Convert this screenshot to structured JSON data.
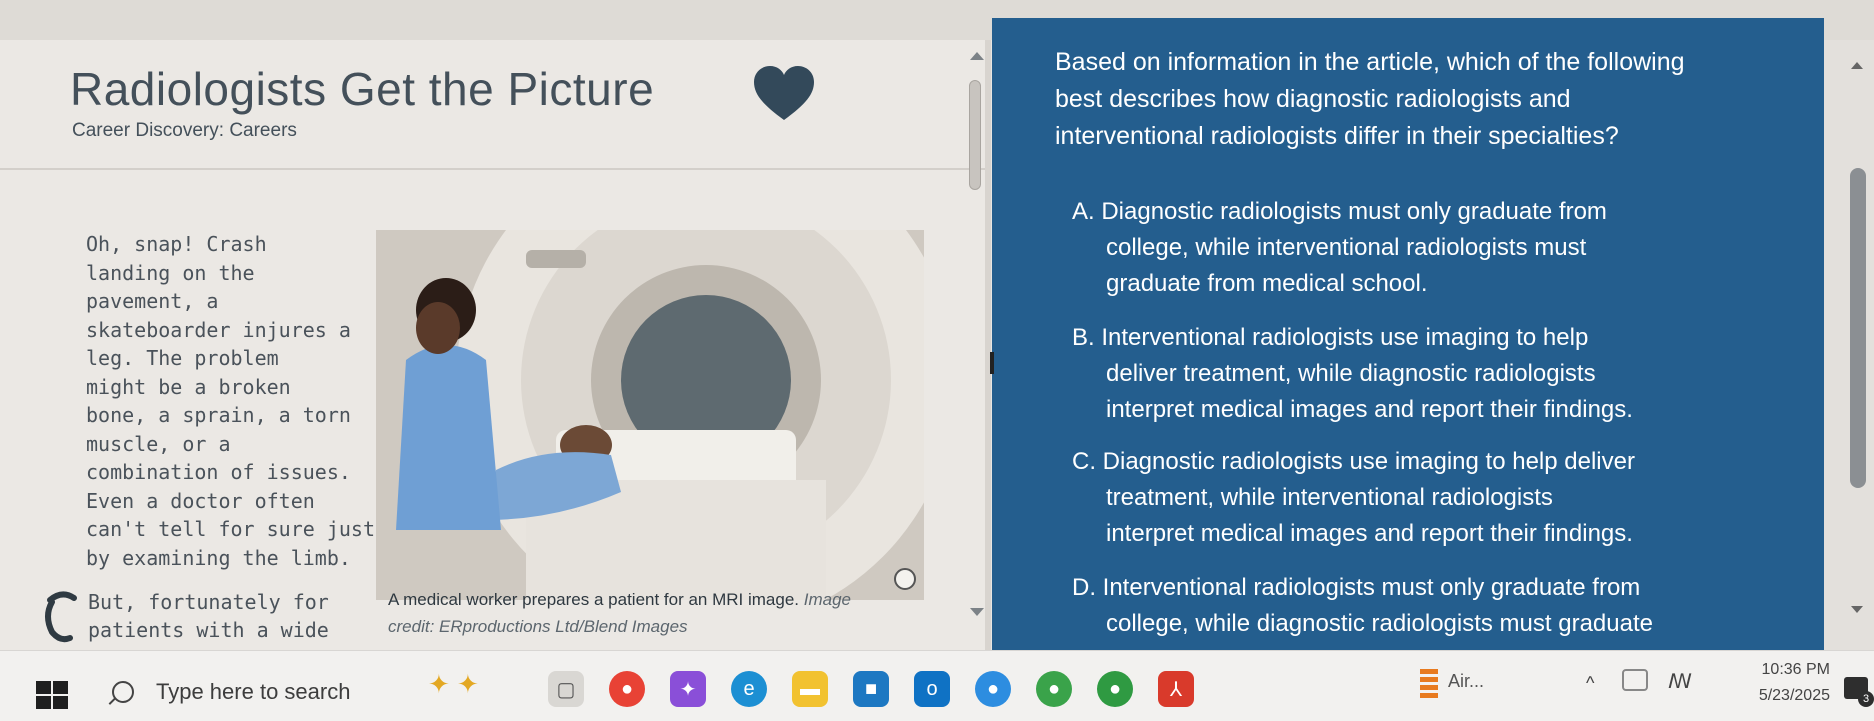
{
  "article": {
    "title": "Radiologists Get the Picture",
    "subtitle": "Career Discovery: Careers",
    "body_lines": [
      "Oh, snap! Crash",
      "landing on the",
      "pavement, a",
      "skateboarder injures a",
      "leg. The problem",
      "might be a broken",
      "bone, a sprain, a torn",
      "muscle, or a",
      "combination of issues.",
      "Even a doctor often",
      "can't tell for sure just",
      "by examining the limb."
    ],
    "more_lines": [
      "But, fortunately for",
      "patients with a wide"
    ],
    "caption_main": "A medical worker prepares a patient for an MRI image.",
    "caption_credit_1": "Image",
    "caption_credit_2": "credit: ERproductions Ltd/Blend Images"
  },
  "question": {
    "prompt_lines": [
      "Based on information in the article, which of the following",
      "best describes how diagnostic radiologists and",
      "interventional radiologists differ in their specialties?"
    ],
    "options": [
      {
        "lines": [
          "A. Diagnostic radiologists must only graduate from",
          "college, while interventional radiologists must",
          "graduate from medical school."
        ]
      },
      {
        "lines": [
          "B. Interventional radiologists use imaging to help",
          "deliver treatment, while diagnostic radiologists",
          "interpret medical images and report their findings."
        ]
      },
      {
        "lines": [
          "C. Diagnostic radiologists use imaging to help deliver",
          "treatment, while interventional radiologists",
          "interpret medical images and report their findings."
        ]
      },
      {
        "lines": [
          "D. Interventional radiologists must only graduate from",
          "college, while diagnostic radiologists must graduate"
        ]
      }
    ]
  },
  "taskbar": {
    "search_placeholder": "Type here to search",
    "weather": "Air...",
    "time": "10:36 PM",
    "date": "5/23/2025",
    "notification_count": "3"
  },
  "colors": {
    "question_bg": "#245e8e",
    "heart": "#33495a"
  }
}
